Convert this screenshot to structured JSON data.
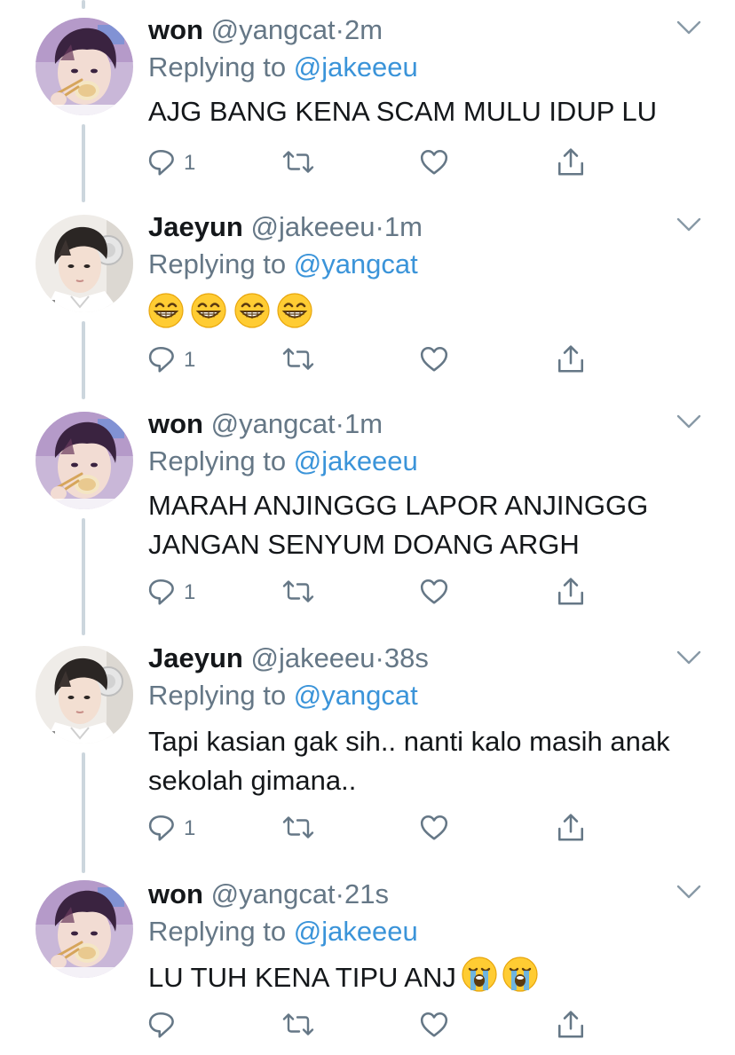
{
  "tweets": [
    {
      "name": "won",
      "handle": "@yangcat",
      "dot": "·",
      "time": "2m",
      "replying_prefix": "Replying to",
      "replying_to": "@jakeeeu",
      "text": "AJG BANG KENA SCAM MULU IDUP LU",
      "reply_count": "1"
    },
    {
      "name": "Jaeyun",
      "handle": "@jakeeeu",
      "dot": "·",
      "time": "1m",
      "replying_prefix": "Replying to",
      "replying_to": "@yangcat",
      "emojis": [
        "grinning-face-icon",
        "grinning-face-icon",
        "grinning-face-icon",
        "grinning-face-icon"
      ],
      "reply_count": "1"
    },
    {
      "name": "won",
      "handle": "@yangcat",
      "dot": "·",
      "time": "1m",
      "replying_prefix": "Replying to",
      "replying_to": "@jakeeeu",
      "text_lines": [
        "MARAH ANJINGGG LAPOR ANJINGGG",
        "JANGAN SENYUM DOANG ARGH"
      ],
      "reply_count": "1"
    },
    {
      "name": "Jaeyun",
      "handle": "@jakeeeu",
      "dot": "·",
      "time": "38s",
      "replying_prefix": "Replying to",
      "replying_to": "@yangcat",
      "text_lines": [
        "Tapi kasian gak sih.. nanti kalo masih anak",
        "sekolah gimana.."
      ],
      "reply_count": "1"
    },
    {
      "name": "won",
      "handle": "@yangcat",
      "dot": "·",
      "time": "21s",
      "replying_prefix": "Replying to",
      "replying_to": "@jakeeeu",
      "text": "LU TUH KENA TIPU ANJ",
      "emojis": [
        "loudly-crying-face-icon",
        "loudly-crying-face-icon"
      ]
    }
  ],
  "icons": {
    "reply": "reply-icon",
    "retweet": "retweet-icon",
    "like": "like-icon",
    "share": "share-icon",
    "caret": "chevron-down-icon"
  },
  "colors": {
    "text": "#14171a",
    "secondary": "#657786",
    "link": "#3b94d9",
    "connector": "#ccd6dd"
  }
}
